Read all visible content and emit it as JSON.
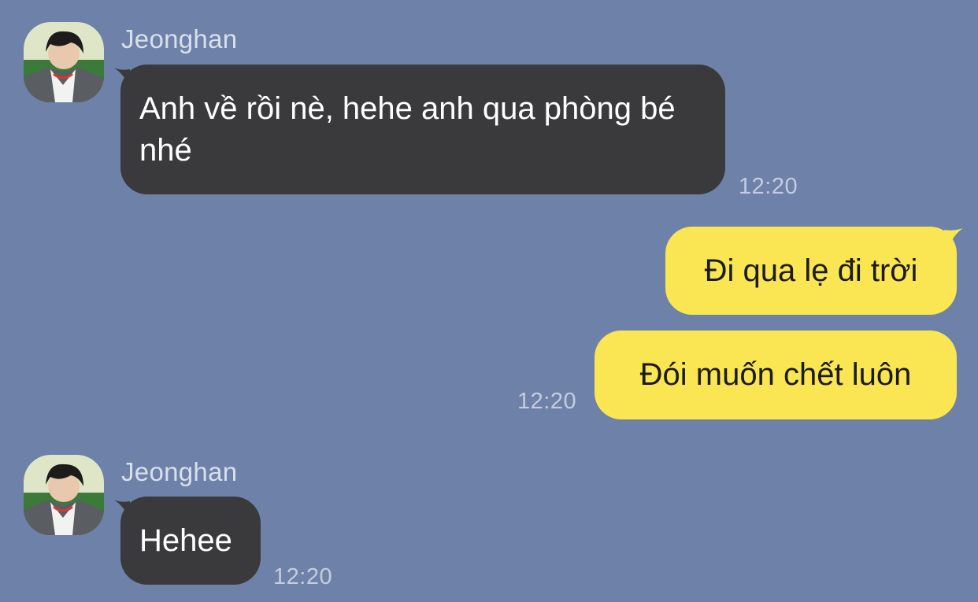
{
  "theme": {
    "background": "#6e81a8",
    "incoming_bubble": "#3a3a3c",
    "outgoing_bubble": "#fae552",
    "meta_text": "#c4cde0"
  },
  "messages": {
    "group1": {
      "avatar_icon": "profile-photo-avatar",
      "sender": "Jeonghan",
      "text": "Anh về rồi nè, hehe anh qua phòng bé nhé",
      "time": "12:20"
    },
    "outgoing1": {
      "text": "Đi qua lẹ đi trời"
    },
    "outgoing2": {
      "text": "Đói muốn chết luôn",
      "time": "12:20"
    },
    "group2": {
      "avatar_icon": "profile-photo-avatar",
      "sender": "Jeonghan",
      "text": "Hehee",
      "time": "12:20"
    }
  }
}
